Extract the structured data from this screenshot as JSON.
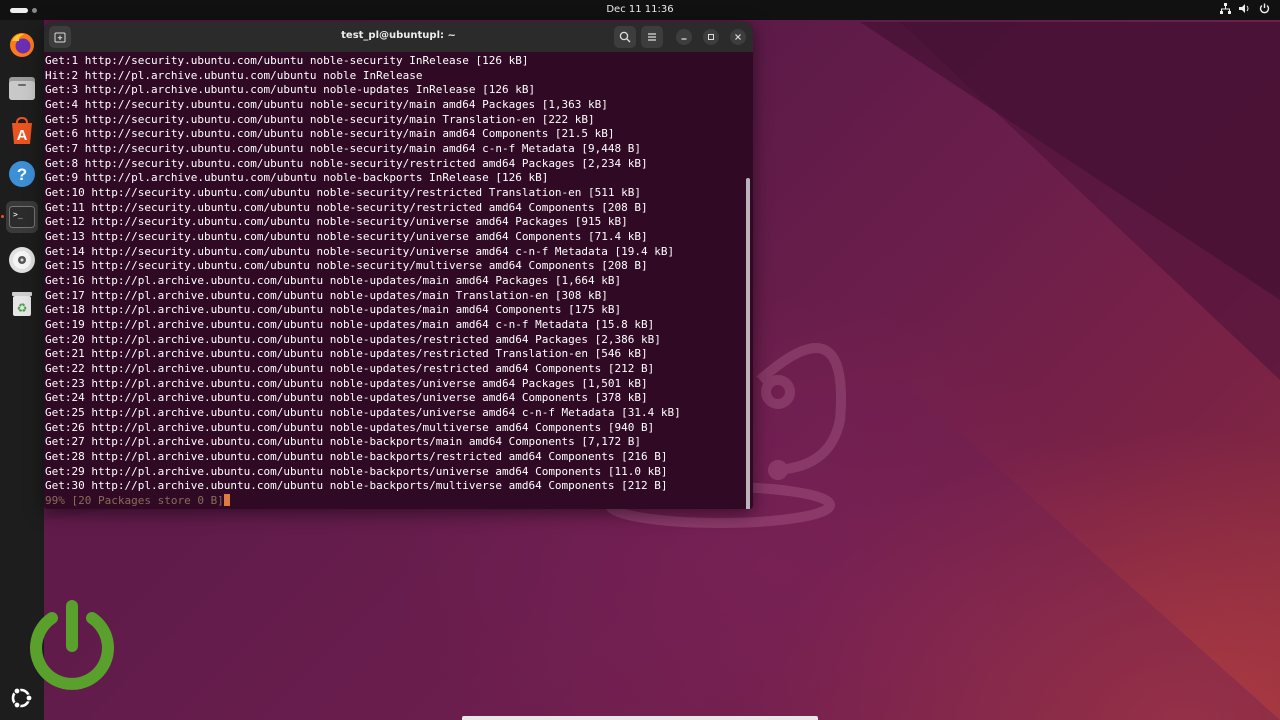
{
  "topbar": {
    "datetime": "Dec 11  11:36",
    "tray_icons": [
      "network-icon",
      "volume-icon",
      "power-icon"
    ]
  },
  "dock": {
    "items": [
      {
        "name": "firefox",
        "icon": "firefox-icon"
      },
      {
        "name": "files",
        "icon": "files-icon"
      },
      {
        "name": "app-center",
        "icon": "app-center-icon"
      },
      {
        "name": "help",
        "icon": "help-icon"
      },
      {
        "name": "terminal",
        "icon": "terminal-icon",
        "active": true
      },
      {
        "name": "disc",
        "icon": "disc-icon"
      },
      {
        "name": "trash",
        "icon": "trash-icon"
      }
    ],
    "help_glyph": "?",
    "terminal_glyph": ">_"
  },
  "window": {
    "title": "test_pl@ubuntupl: ~"
  },
  "terminal": {
    "lines": [
      "Get:1 http://security.ubuntu.com/ubuntu noble-security InRelease [126 kB]",
      "Hit:2 http://pl.archive.ubuntu.com/ubuntu noble InRelease",
      "Get:3 http://pl.archive.ubuntu.com/ubuntu noble-updates InRelease [126 kB]",
      "Get:4 http://security.ubuntu.com/ubuntu noble-security/main amd64 Packages [1,363 kB]",
      "Get:5 http://security.ubuntu.com/ubuntu noble-security/main Translation-en [222 kB]",
      "Get:6 http://security.ubuntu.com/ubuntu noble-security/main amd64 Components [21.5 kB]",
      "Get:7 http://security.ubuntu.com/ubuntu noble-security/main amd64 c-n-f Metadata [9,448 B]",
      "Get:8 http://security.ubuntu.com/ubuntu noble-security/restricted amd64 Packages [2,234 kB]",
      "Get:9 http://pl.archive.ubuntu.com/ubuntu noble-backports InRelease [126 kB]",
      "Get:10 http://security.ubuntu.com/ubuntu noble-security/restricted Translation-en [511 kB]",
      "Get:11 http://security.ubuntu.com/ubuntu noble-security/restricted amd64 Components [208 B]",
      "Get:12 http://security.ubuntu.com/ubuntu noble-security/universe amd64 Packages [915 kB]",
      "Get:13 http://security.ubuntu.com/ubuntu noble-security/universe amd64 Components [71.4 kB]",
      "Get:14 http://security.ubuntu.com/ubuntu noble-security/universe amd64 c-n-f Metadata [19.4 kB]",
      "Get:15 http://security.ubuntu.com/ubuntu noble-security/multiverse amd64 Components [208 B]",
      "Get:16 http://pl.archive.ubuntu.com/ubuntu noble-updates/main amd64 Packages [1,664 kB]",
      "Get:17 http://pl.archive.ubuntu.com/ubuntu noble-updates/main Translation-en [308 kB]",
      "Get:18 http://pl.archive.ubuntu.com/ubuntu noble-updates/main amd64 Components [175 kB]",
      "Get:19 http://pl.archive.ubuntu.com/ubuntu noble-updates/main amd64 c-n-f Metadata [15.8 kB]",
      "Get:20 http://pl.archive.ubuntu.com/ubuntu noble-updates/restricted amd64 Packages [2,386 kB]",
      "Get:21 http://pl.archive.ubuntu.com/ubuntu noble-updates/restricted Translation-en [546 kB]",
      "Get:22 http://pl.archive.ubuntu.com/ubuntu noble-updates/restricted amd64 Components [212 B]",
      "Get:23 http://pl.archive.ubuntu.com/ubuntu noble-updates/universe amd64 Packages [1,501 kB]",
      "Get:24 http://pl.archive.ubuntu.com/ubuntu noble-updates/universe amd64 Components [378 kB]",
      "Get:25 http://pl.archive.ubuntu.com/ubuntu noble-updates/universe amd64 c-n-f Metadata [31.4 kB]",
      "Get:26 http://pl.archive.ubuntu.com/ubuntu noble-updates/multiverse amd64 Components [940 B]",
      "Get:27 http://pl.archive.ubuntu.com/ubuntu noble-backports/main amd64 Components [7,172 B]",
      "Get:28 http://pl.archive.ubuntu.com/ubuntu noble-backports/restricted amd64 Components [216 B]",
      "Get:29 http://pl.archive.ubuntu.com/ubuntu noble-backports/universe amd64 Components [11.0 kB]",
      "Get:30 http://pl.archive.ubuntu.com/ubuntu noble-backports/multiverse amd64 Components [212 B]"
    ],
    "progress": "99% [20 Packages store 0 B]"
  },
  "colors": {
    "terminal_bg": "#300a24",
    "terminal_fg": "#ffffff",
    "progress_fg": "#8a6b5a",
    "cursor": "#e07a43",
    "accent": "#e95420",
    "power_logo": "#5aa02c"
  }
}
